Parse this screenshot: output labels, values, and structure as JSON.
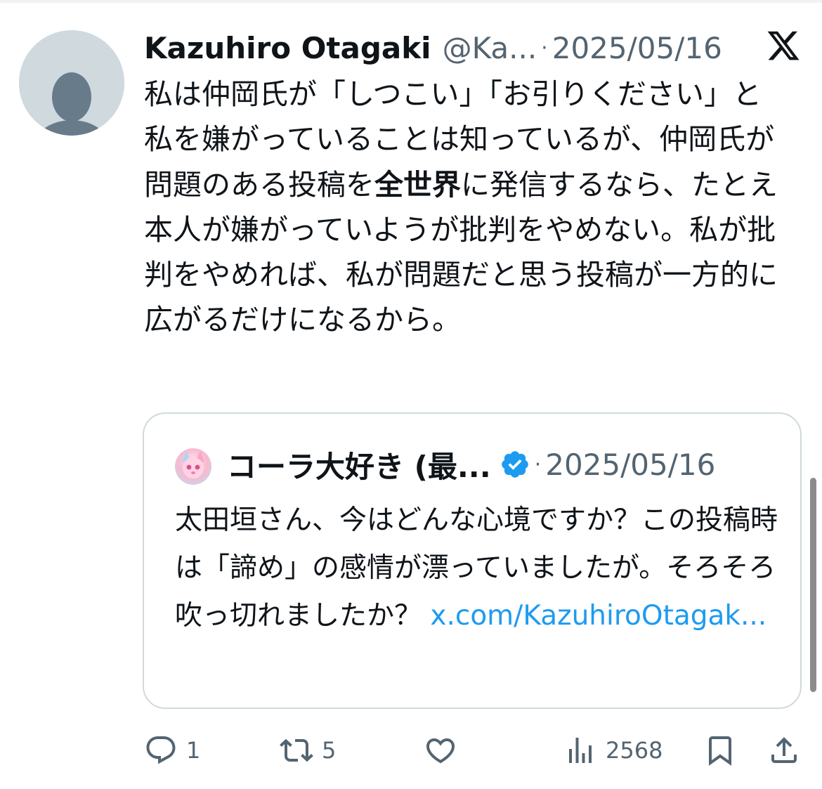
{
  "tweet": {
    "author_name": "Kazuhiro Otagaki",
    "author_handle": "@Ka...",
    "date": "2025/05/16",
    "separator": "·",
    "text_before_bold": "私は仲岡氏が「しつこい」「お引りください」と私を嫌がっていることは知っているが、仲岡氏が問題のある投稿を",
    "text_bold": "全世界",
    "text_after_bold": "に発信するなら、たとえ本人が嫌がっていようが批判をやめない。私が批判をやめれば、私が問題だと思う投稿が一方的に広がるだけになるから。"
  },
  "quote": {
    "author_name": "コーラ大好き (最...",
    "date": "2025/05/16",
    "separator": "·",
    "text": "太田垣さん、今はどんな心境ですか？この投稿時は「諦め」の感情が漂っていましたが。そろそろ吹っ切れましたか？ ",
    "link": "x.com/KazuhiroOtagak..."
  },
  "actions": {
    "reply_count": "1",
    "retweet_count": "5",
    "views_count": "2568"
  },
  "colors": {
    "text": "#0f1419",
    "secondary": "#536471",
    "link": "#1d9bf0",
    "verified": "#1d9bf0",
    "border": "#cfd9de",
    "avatar_bg": "#cfd9de",
    "avatar_fg": "#687b8b"
  },
  "icons": {
    "platform": "x-logo-icon",
    "verified": "verified-badge-icon",
    "reply": "reply-icon",
    "retweet": "retweet-icon",
    "like": "heart-icon",
    "views": "views-icon",
    "bookmark": "bookmark-icon",
    "share": "share-icon"
  }
}
